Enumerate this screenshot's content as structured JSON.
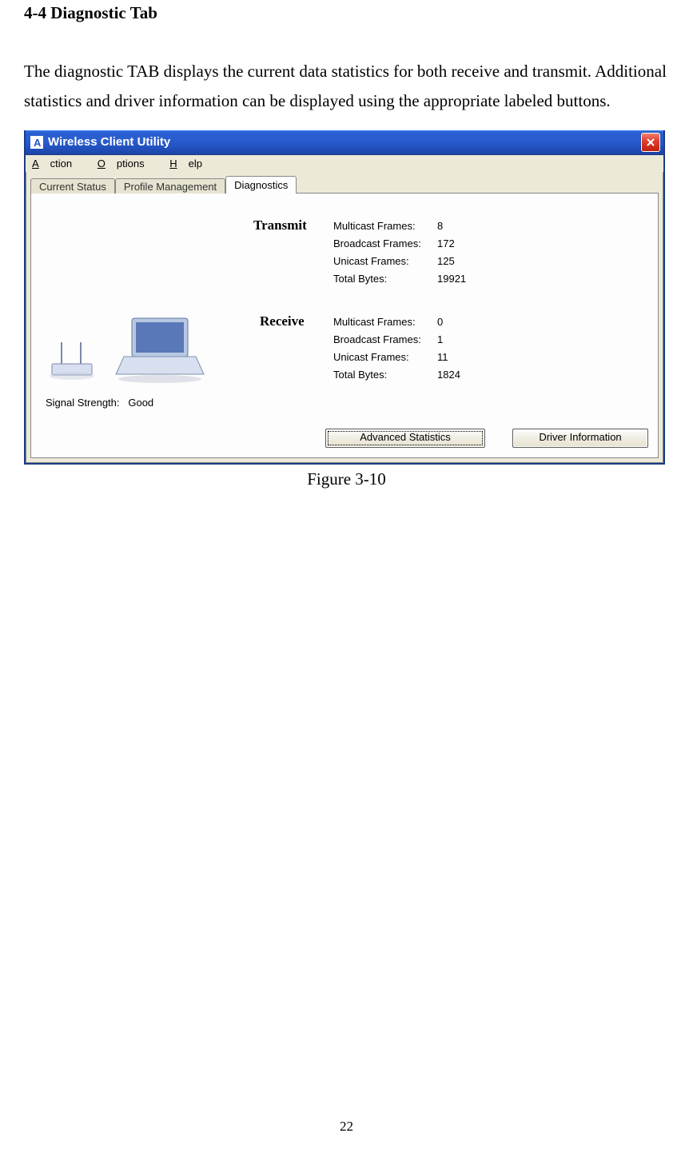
{
  "heading": "4-4 Diagnostic Tab",
  "paragraph": "The diagnostic TAB displays the current data statistics for both receive and transmit. Additional statistics and driver information can be displayed using the appropriate labeled buttons.",
  "window": {
    "title": "Wireless Client Utility",
    "app_icon_letter": "A",
    "menus": {
      "action": "Action",
      "options": "Options",
      "help": "Help"
    },
    "tabs": {
      "current_status": "Current Status",
      "profile_management": "Profile Management",
      "diagnostics": "Diagnostics"
    },
    "transmit": {
      "heading": "Transmit",
      "rows": [
        {
          "label": "Multicast Frames:",
          "value": "8"
        },
        {
          "label": "Broadcast Frames:",
          "value": "172"
        },
        {
          "label": "Unicast Frames:",
          "value": "125"
        },
        {
          "label": "Total Bytes:",
          "value": "19921"
        }
      ]
    },
    "receive": {
      "heading": "Receive",
      "rows": [
        {
          "label": "Multicast Frames:",
          "value": "0"
        },
        {
          "label": "Broadcast Frames:",
          "value": "1"
        },
        {
          "label": "Unicast Frames:",
          "value": "11"
        },
        {
          "label": "Total Bytes:",
          "value": "1824"
        }
      ]
    },
    "signal_strength_label": "Signal Strength:",
    "signal_strength_value": "Good",
    "buttons": {
      "advanced_statistics": "Advanced Statistics",
      "driver_information": "Driver Information"
    }
  },
  "caption": "Figure 3-10",
  "page_number": "22"
}
